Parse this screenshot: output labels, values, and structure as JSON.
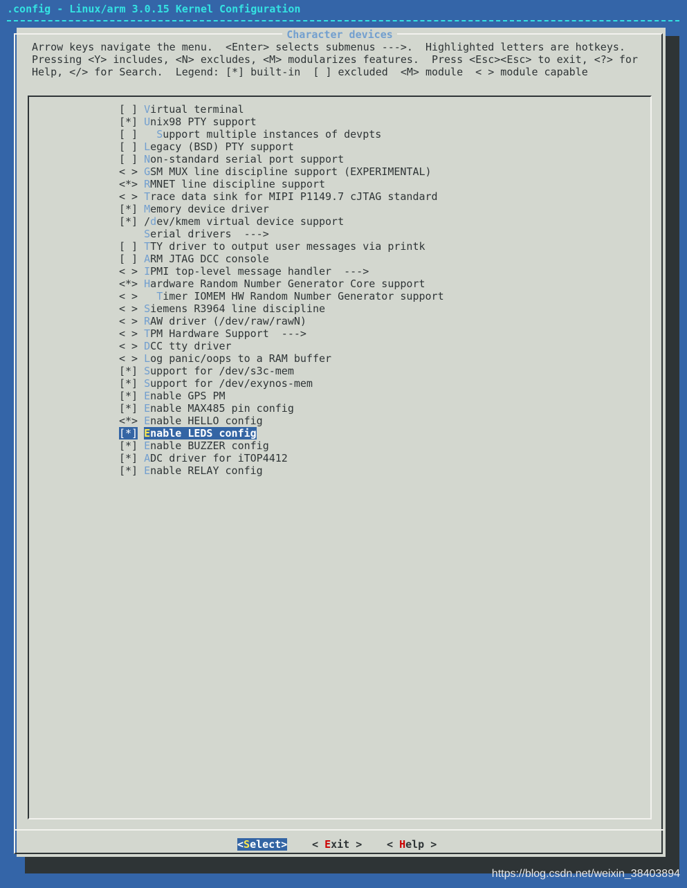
{
  "window": {
    "title": ".config - Linux/arm 3.0.15 Kernel Configuration"
  },
  "dialog": {
    "title": "Character devices",
    "help_lines": [
      "Arrow keys navigate the menu.  <Enter> selects submenus --->.  Highlighted letters are hotkeys.",
      "Pressing <Y> includes, <N> excludes, <M> modularizes features.  Press <Esc><Esc> to exit, <?> for",
      "Help, </> for Search.  Legend: [*] built-in  [ ] excluded  <M> module  < > module capable"
    ]
  },
  "menu": {
    "items": [
      {
        "prefix": "[ ] ",
        "pre": "",
        "key": "V",
        "post": "irtual terminal"
      },
      {
        "prefix": "[*] ",
        "pre": "",
        "key": "U",
        "post": "nix98 PTY support"
      },
      {
        "prefix": "[ ] ",
        "pre": "  ",
        "key": "S",
        "post": "upport multiple instances of devpts"
      },
      {
        "prefix": "[ ] ",
        "pre": "",
        "key": "L",
        "post": "egacy (BSD) PTY support"
      },
      {
        "prefix": "[ ] ",
        "pre": "",
        "key": "N",
        "post": "on-standard serial port support"
      },
      {
        "prefix": "< > ",
        "pre": "",
        "key": "G",
        "post": "SM MUX line discipline support (EXPERIMENTAL)"
      },
      {
        "prefix": "<*> ",
        "pre": "",
        "key": "R",
        "post": "MNET line discipline support"
      },
      {
        "prefix": "< > ",
        "pre": "",
        "key": "T",
        "post": "race data sink for MIPI P1149.7 cJTAG standard"
      },
      {
        "prefix": "[*] ",
        "pre": "",
        "key": "M",
        "post": "emory device driver"
      },
      {
        "prefix": "[*] ",
        "pre": "/",
        "key": "d",
        "post": "ev/kmem virtual device support"
      },
      {
        "prefix": "    ",
        "pre": "",
        "key": "S",
        "post": "erial drivers  --->"
      },
      {
        "prefix": "[ ] ",
        "pre": "",
        "key": "T",
        "post": "TY driver to output user messages via printk"
      },
      {
        "prefix": "[ ] ",
        "pre": "",
        "key": "A",
        "post": "RM JTAG DCC console"
      },
      {
        "prefix": "< > ",
        "pre": "",
        "key": "I",
        "post": "PMI top-level message handler  --->"
      },
      {
        "prefix": "<*> ",
        "pre": "",
        "key": "H",
        "post": "ardware Random Number Generator Core support"
      },
      {
        "prefix": "< > ",
        "pre": "  ",
        "key": "T",
        "post": "imer IOMEM HW Random Number Generator support"
      },
      {
        "prefix": "< > ",
        "pre": "",
        "key": "S",
        "post": "iemens R3964 line discipline"
      },
      {
        "prefix": "< > ",
        "pre": "",
        "key": "R",
        "post": "AW driver (/dev/raw/rawN)"
      },
      {
        "prefix": "< > ",
        "pre": "",
        "key": "T",
        "post": "PM Hardware Support  --->"
      },
      {
        "prefix": "< > ",
        "pre": "",
        "key": "D",
        "post": "CC tty driver"
      },
      {
        "prefix": "< > ",
        "pre": "",
        "key": "L",
        "post": "og panic/oops to a RAM buffer"
      },
      {
        "prefix": "[*] ",
        "pre": "",
        "key": "S",
        "post": "upport for /dev/s3c-mem"
      },
      {
        "prefix": "[*] ",
        "pre": "",
        "key": "S",
        "post": "upport for /dev/exynos-mem"
      },
      {
        "prefix": "[*] ",
        "pre": "",
        "key": "E",
        "post": "nable GPS PM"
      },
      {
        "prefix": "[*] ",
        "pre": "",
        "key": "E",
        "post": "nable MAX485 pin config"
      },
      {
        "prefix": "<*> ",
        "pre": "",
        "key": "E",
        "post": "nable HELLO config"
      },
      {
        "prefix": "[*] ",
        "pre": "",
        "key": "E",
        "post": "nable LEDS config",
        "selected": true
      },
      {
        "prefix": "[*] ",
        "pre": "",
        "key": "E",
        "post": "nable BUZZER config"
      },
      {
        "prefix": "[*] ",
        "pre": "",
        "key": "A",
        "post": "DC driver for iTOP4412"
      },
      {
        "prefix": "[*] ",
        "pre": "",
        "key": "E",
        "post": "nable RELAY config"
      }
    ]
  },
  "buttons": [
    {
      "pre": "<",
      "key": "S",
      "post": "elect>",
      "selected": true
    },
    {
      "pre": "< ",
      "key": "E",
      "post": "xit >"
    },
    {
      "pre": "< ",
      "key": "H",
      "post": "elp >"
    }
  ],
  "watermark": "https://blog.csdn.net/weixin_38403894",
  "colors": {
    "background": "#3465a8",
    "dialog": "#d3d7cf",
    "hotkey": "#729fcf",
    "selection": "#3465a4",
    "selected_hotkey": "#fce94f",
    "button_hotkey": "#cc0000",
    "title": "#34e2e2"
  }
}
